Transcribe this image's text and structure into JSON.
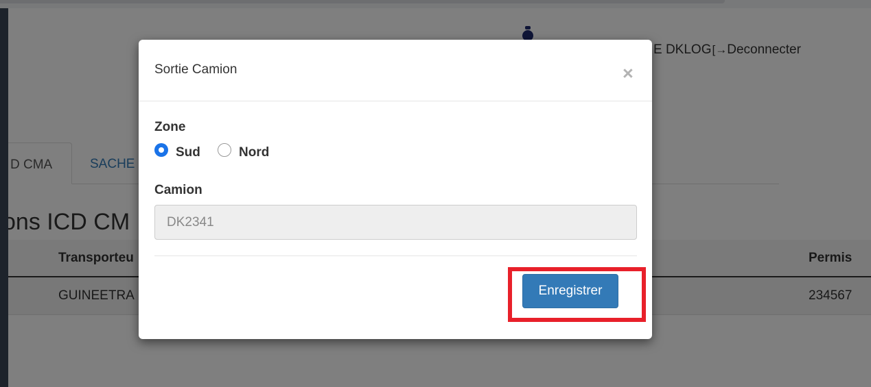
{
  "header": {
    "user_text": "E DKLOG",
    "logout_icon": "logout-icon",
    "logout_label": "Deconnecter"
  },
  "tabs": [
    {
      "label": "D CMA"
    },
    {
      "label": "SACHE"
    }
  ],
  "section": {
    "title": "ons ICD CM"
  },
  "table": {
    "headers": {
      "transporteur": "Transporteu",
      "permis": "Permis"
    },
    "rows": [
      {
        "transporteur": "GUINEETRA",
        "permis": "234567"
      }
    ]
  },
  "modal": {
    "title": "Sortie Camion",
    "close_symbol": "×",
    "zone_label": "Zone",
    "zone_options": [
      {
        "label": "Sud",
        "checked": true
      },
      {
        "label": "Nord",
        "checked": false
      }
    ],
    "camion_label": "Camion",
    "camion_value": "DK2341",
    "save_label": "Enregistrer"
  },
  "colors": {
    "primary_button": "#337ab7",
    "highlight": "#e8202a",
    "radio_checked": "#1a73e8"
  }
}
